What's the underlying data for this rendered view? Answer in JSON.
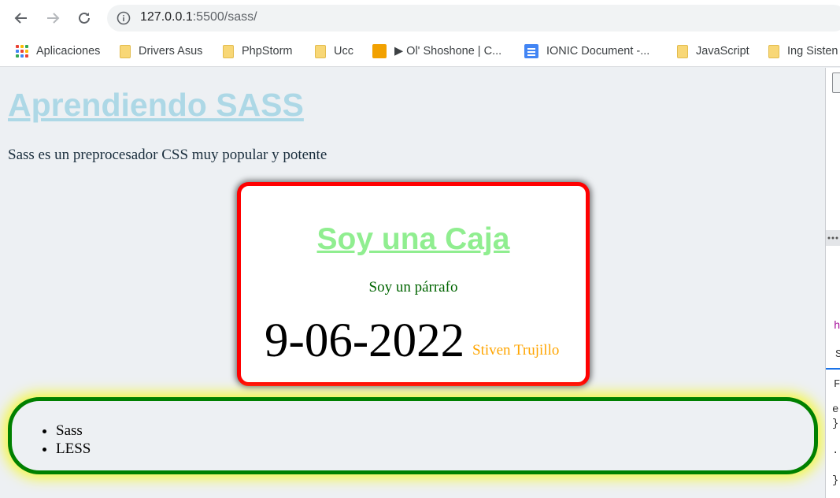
{
  "browser": {
    "url_host": "127.0.0.1",
    "url_rest": ":5500/sass/",
    "bookmarks": [
      {
        "label": "Aplicaciones",
        "icon": "apps-grid-icon"
      },
      {
        "label": "Drivers Asus",
        "icon": "folder-icon"
      },
      {
        "label": "PhpStorm",
        "icon": "folder-icon"
      },
      {
        "label": "Ucc",
        "icon": "folder-icon"
      },
      {
        "label": "▶ Ol' Shoshone | C...",
        "icon": "youtube-music-icon"
      },
      {
        "label": "IONIC Document -...",
        "icon": "google-docs-icon"
      },
      {
        "label": "JavaScript",
        "icon": "folder-icon"
      },
      {
        "label": "Ing Sisten",
        "icon": "folder-icon"
      }
    ]
  },
  "page": {
    "title": "Aprendiendo SASS",
    "intro": "Sass es un preprocesador CSS muy popular y potente",
    "caja": {
      "title": "Soy una Caja",
      "paragraph": "Soy un párrafo",
      "date": "9-06-2022",
      "author": "Stiven Trujillo"
    },
    "list": [
      "Sass",
      "LESS"
    ]
  },
  "devtools": {
    "fragments": [
      "h",
      "S",
      "F",
      "e",
      "}",
      ".",
      "}"
    ]
  },
  "colors": {
    "title": "#add8e6",
    "caja_border": "#ff0000",
    "caja_title": "#90ee90",
    "caja_paragraph": "#006400",
    "author": "#ffa500",
    "list_border": "#008000",
    "list_glow": "#f4f74a"
  }
}
